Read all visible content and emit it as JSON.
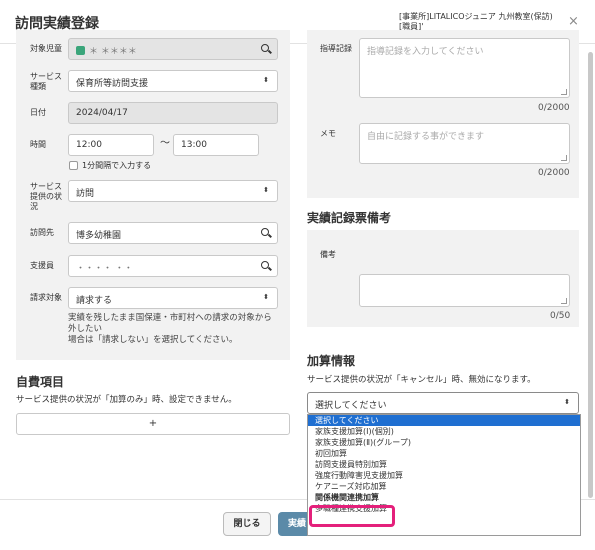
{
  "header": {
    "title": "訪問実績登録",
    "office_line1": "[事業所]LITALICOジュニア 九州教室(保訪)",
    "office_line2": "[職員]'",
    "close_glyph": "×"
  },
  "form": {
    "target_child": {
      "label": "対象児童",
      "value": "＊ ＊＊＊＊"
    },
    "service_type": {
      "label_l1": "サービス",
      "label_l2": "種類",
      "value": "保育所等訪問支援"
    },
    "date": {
      "label": "日付",
      "value": "2024/04/17"
    },
    "time": {
      "label": "時間",
      "start": "12:00",
      "separator": "〜",
      "end": "13:00",
      "checkbox_label": "1分間隔で入力する"
    },
    "service_status": {
      "label_l1": "サービス",
      "label_l2": "提供の状",
      "label_l3": "況",
      "value": "訪問"
    },
    "visit_place": {
      "label": "訪問先",
      "value": "博多幼稚園"
    },
    "staff": {
      "label": "支援員",
      "value": "・・・・ ・・"
    },
    "billing": {
      "label": "請求対象",
      "value": "請求する",
      "note_l1": "実績を残したまま国保連・市町村への請求の対象から",
      "note_l2": "外したい",
      "note_l3": "場合は「請求しない」を選択してください。"
    }
  },
  "self_pay": {
    "heading": "自費項目",
    "description": "サービス提供の状況が「加算のみ」時、設定できません。",
    "add_label": "+"
  },
  "guidance": {
    "label": "指導記録",
    "placeholder": "指導記録を入力してください",
    "counter": "0/2000"
  },
  "memo": {
    "label": "メモ",
    "placeholder": "自由に記録する事ができます",
    "counter": "0/2000"
  },
  "remarks_section": {
    "heading": "実績記録票備考",
    "label": "備考",
    "counter": "0/50"
  },
  "addition": {
    "heading": "加算情報",
    "description": "サービス提供の状況が「キャンセル」時、無効になります。",
    "select_value": "選択してください",
    "options": [
      "選択してください",
      "家族支援加算(Ⅰ)(個別)",
      "家族支援加算(Ⅱ)(グループ)",
      "初回加算",
      "訪問支援員特別加算",
      "強度行動障害児支援加算",
      "ケアニーズ対応加算",
      "関係機関連携加算",
      "多職種連携支援加算"
    ],
    "selected_index": 0,
    "highlighted_option": "関係機関連携加算",
    "highlight_color": "#e4207b"
  },
  "footer": {
    "close_label": "閉じる",
    "save_label": "実績"
  },
  "colors": {
    "panel_bg": "#f2f2f2",
    "selected_option": "#1f6fd1",
    "save_button": "#5b8aa8"
  }
}
